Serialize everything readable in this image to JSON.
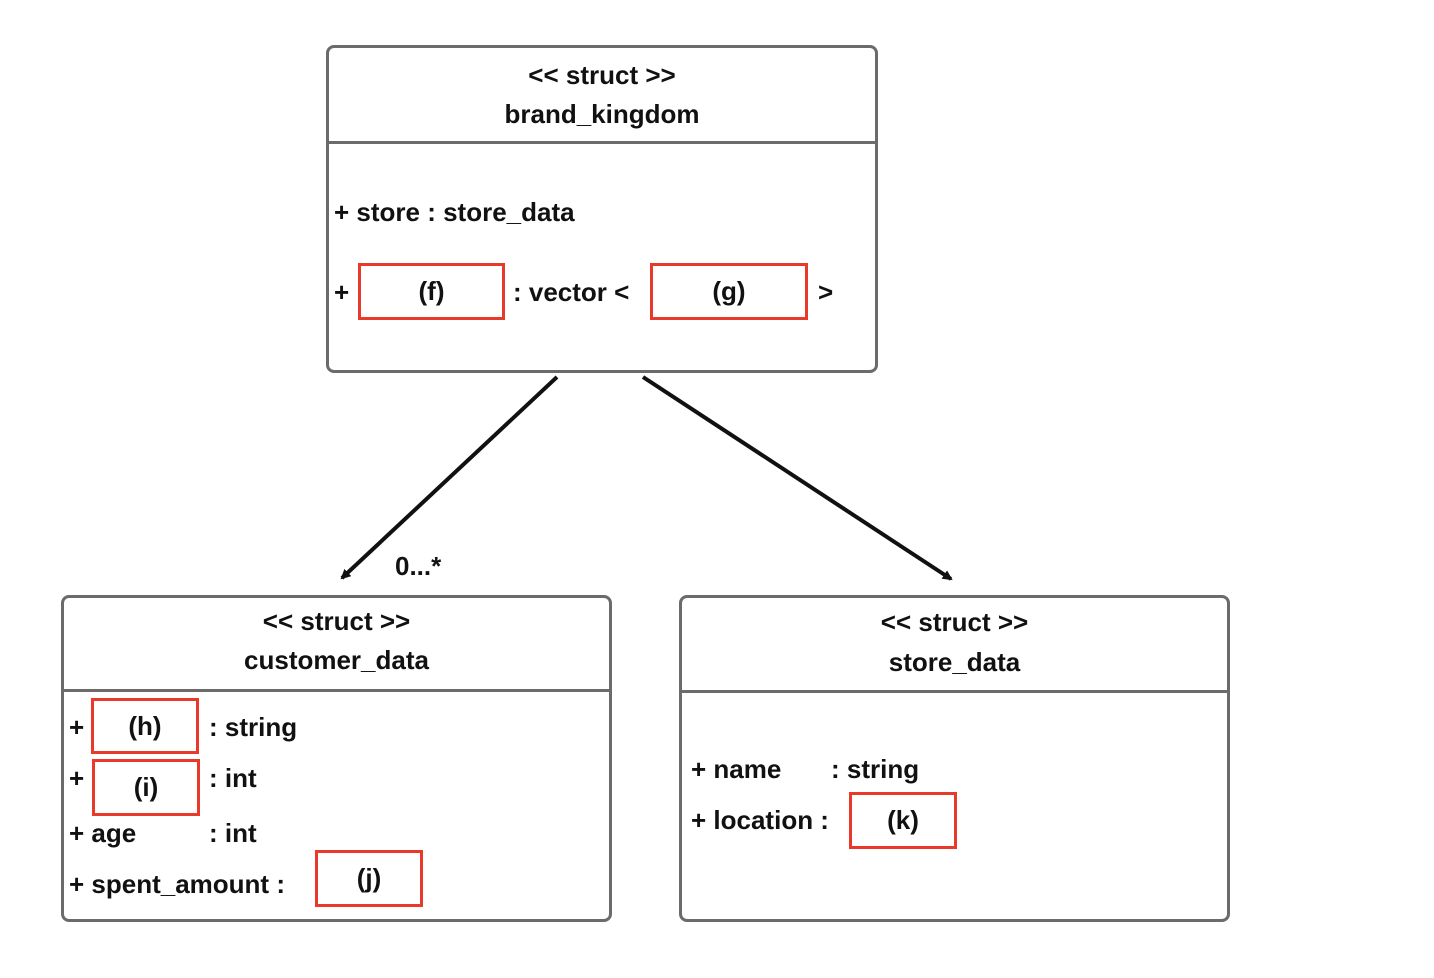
{
  "colors": {
    "border": "#6b6b6b",
    "blank_highlight": "#e8392a",
    "arrow": "#111111"
  },
  "structs": {
    "brand_kingdom": {
      "stereotype": "<< struct >>",
      "name": "brand_kingdom",
      "attr1": "+ store : store_data",
      "attr2_prefix": "+",
      "attr2_blank": "(f)",
      "attr2_type": ": vector <",
      "attr2_blank2": "(g)",
      "attr2_close": ">"
    },
    "customer_data": {
      "stereotype": "<< struct >>",
      "name": "customer_data",
      "attr1_prefix": "+",
      "attr1_blank": "(h)",
      "attr1_type": ": string",
      "attr2_prefix": "+",
      "attr2_blank": "(i)",
      "attr2_type": ": int",
      "attr3_name": "+ age",
      "attr3_type": ": int",
      "attr4_name": "+ spent_amount :",
      "attr4_blank": "(j)"
    },
    "store_data": {
      "stereotype": "<< struct >>",
      "name": "store_data",
      "attr1_name": "+ name",
      "attr1_type": ": string",
      "attr2_name": "+ location :",
      "attr2_blank": "(k)"
    }
  },
  "relations": [
    {
      "from": "brand_kingdom",
      "to": "customer_data",
      "multiplicity": "0...*"
    },
    {
      "from": "brand_kingdom",
      "to": "store_data"
    }
  ]
}
